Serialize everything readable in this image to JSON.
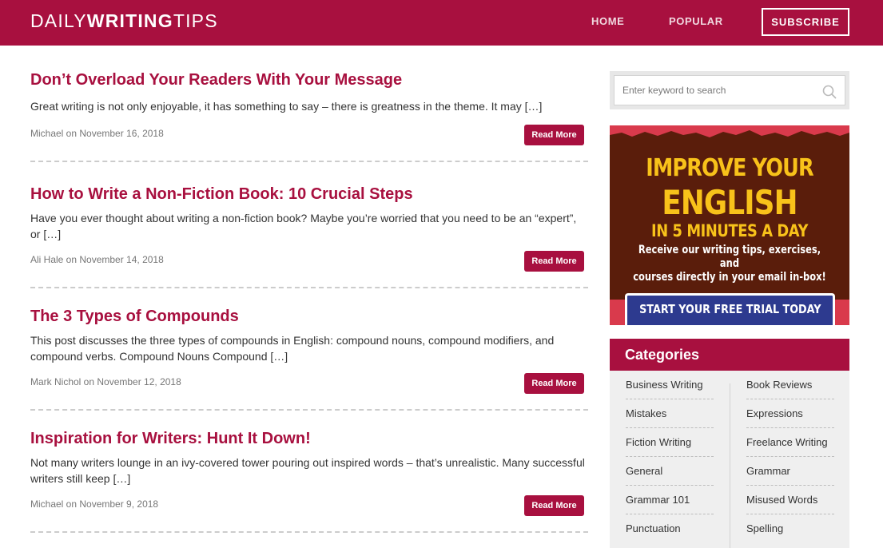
{
  "header": {
    "logo_part1": "DAILY",
    "logo_part2": "WRITING",
    "logo_part3": "TIPS",
    "nav": {
      "home": "HOME",
      "popular": "POPULAR"
    },
    "subscribe_label": "SUBSCRIBE"
  },
  "posts": [
    {
      "title": "Don’t Overload Your Readers With Your Message",
      "excerpt": "Great writing is not only enjoyable, it has something to say – there is greatness in the theme. It may […]",
      "meta": "Michael on November 16, 2018",
      "read_more": "Read More"
    },
    {
      "title": "How to Write a Non-Fiction Book: 10 Crucial Steps",
      "excerpt": "Have you ever thought about writing a non-fiction book? Maybe you’re worried that you need to be an “expert”, or […]",
      "meta": "Ali Hale on November 14, 2018",
      "read_more": "Read More"
    },
    {
      "title": "The 3 Types of Compounds",
      "excerpt": "This post discusses the three types of compounds in English: compound nouns, compound modifiers, and compound verbs. Compound Nouns Compound […]",
      "meta": "Mark Nichol on November 12, 2018",
      "read_more": "Read More"
    },
    {
      "title": "Inspiration for Writers: Hunt It Down!",
      "excerpt": "Not many writers lounge in an ivy-covered tower pouring out inspired words – that’s unrealistic. Many successful writers still keep […]",
      "meta": "Michael on November 9, 2018",
      "read_more": "Read More"
    }
  ],
  "search": {
    "placeholder": "Enter keyword to search"
  },
  "banner": {
    "line1": "IMPROVE YOUR",
    "line2": "ENGLISH",
    "line3": "IN 5 MINUTES A DAY",
    "line4": "Receive our writing tips, exercises, and",
    "line5": "courses directly in your email in-box!",
    "button": "START YOUR FREE TRIAL TODAY"
  },
  "categories": {
    "title": "Categories",
    "left": [
      "Business Writing",
      "Mistakes",
      "Fiction Writing",
      "General",
      "Grammar 101",
      "Punctuation"
    ],
    "right": [
      "Book Reviews",
      "Expressions",
      "Freelance Writing",
      "Grammar",
      "Misused Words",
      "Spelling"
    ]
  },
  "colors": {
    "brand": "#a8103f",
    "banner_brown": "#5a1d0b",
    "banner_yellow": "#f8c21a",
    "banner_button": "#2d3a8f"
  }
}
